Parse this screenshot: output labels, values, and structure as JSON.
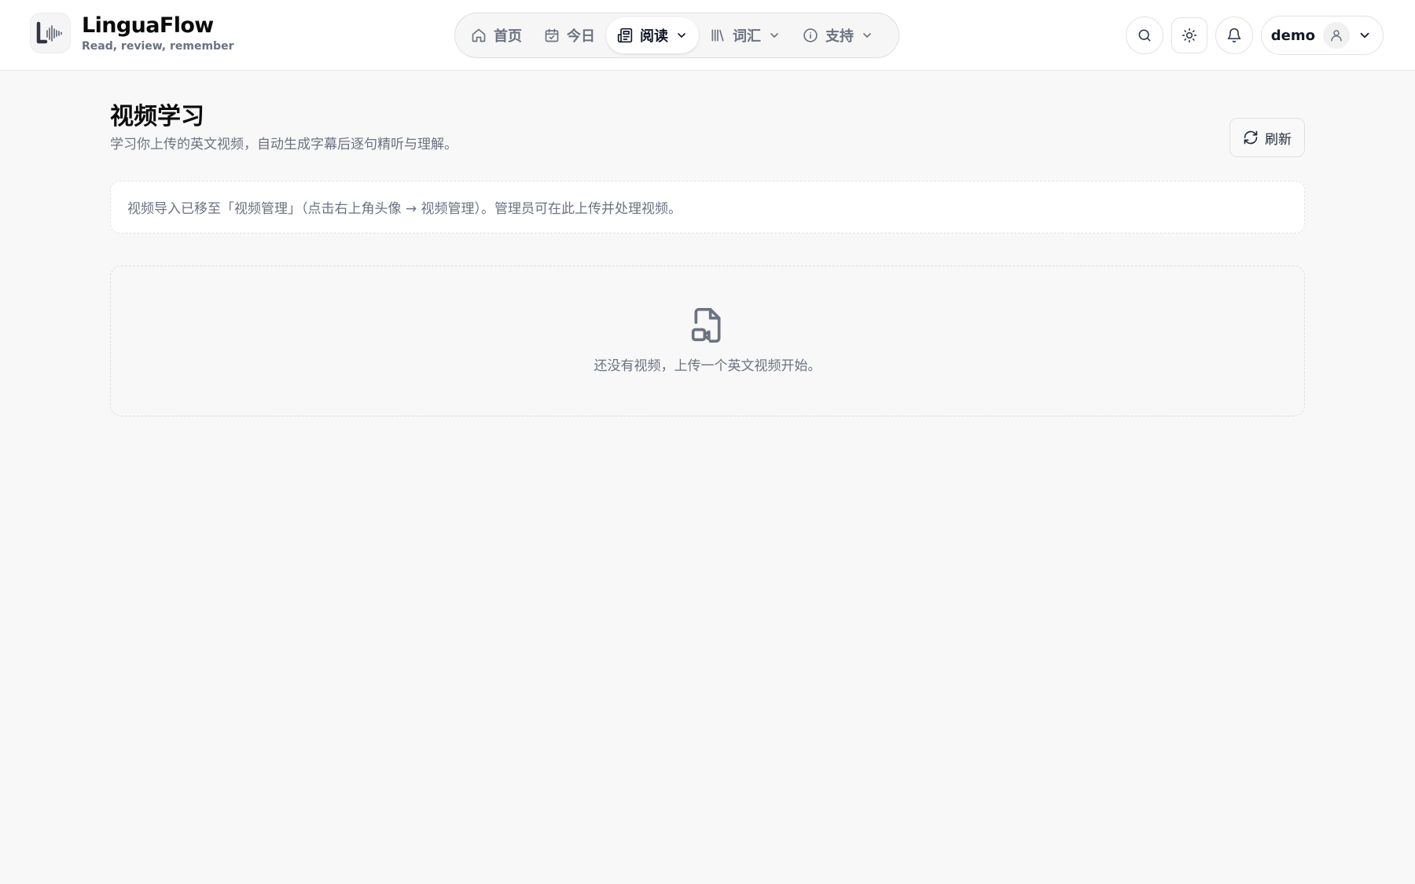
{
  "brand": {
    "name": "LinguaFlow",
    "tagline": "Read, review, remember"
  },
  "nav": {
    "items": [
      {
        "label": "首页",
        "icon": "home-icon"
      },
      {
        "label": "今日",
        "icon": "calendar-check-icon"
      },
      {
        "label": "阅读",
        "icon": "newspaper-icon",
        "active": true,
        "dropdown": true
      },
      {
        "label": "词汇",
        "icon": "library-icon",
        "dropdown": true
      },
      {
        "label": "支持",
        "icon": "info-icon",
        "dropdown": true
      }
    ]
  },
  "header_actions": {
    "search_icon": "search-icon",
    "theme_icon": "sun-icon",
    "notification_icon": "bell-icon",
    "user": {
      "name": "demo",
      "icon": "user-icon"
    }
  },
  "page": {
    "title": "视频学习",
    "subtitle": "学习你上传的英文视频，自动生成字幕后逐句精听与理解。",
    "refresh_label": "刷新"
  },
  "notice": {
    "text": "视频导入已移至「视频管理」（点击右上角头像 → 视频管理）。管理员可在此上传并处理视频。"
  },
  "empty_state": {
    "icon": "file-video-icon",
    "text": "还没有视频，上传一个英文视频开始。"
  },
  "colors": {
    "background": "#f8f8f8",
    "header": "#ffffff",
    "text_primary": "#111827",
    "text_muted": "#6b7280",
    "border": "#e5e7eb"
  }
}
